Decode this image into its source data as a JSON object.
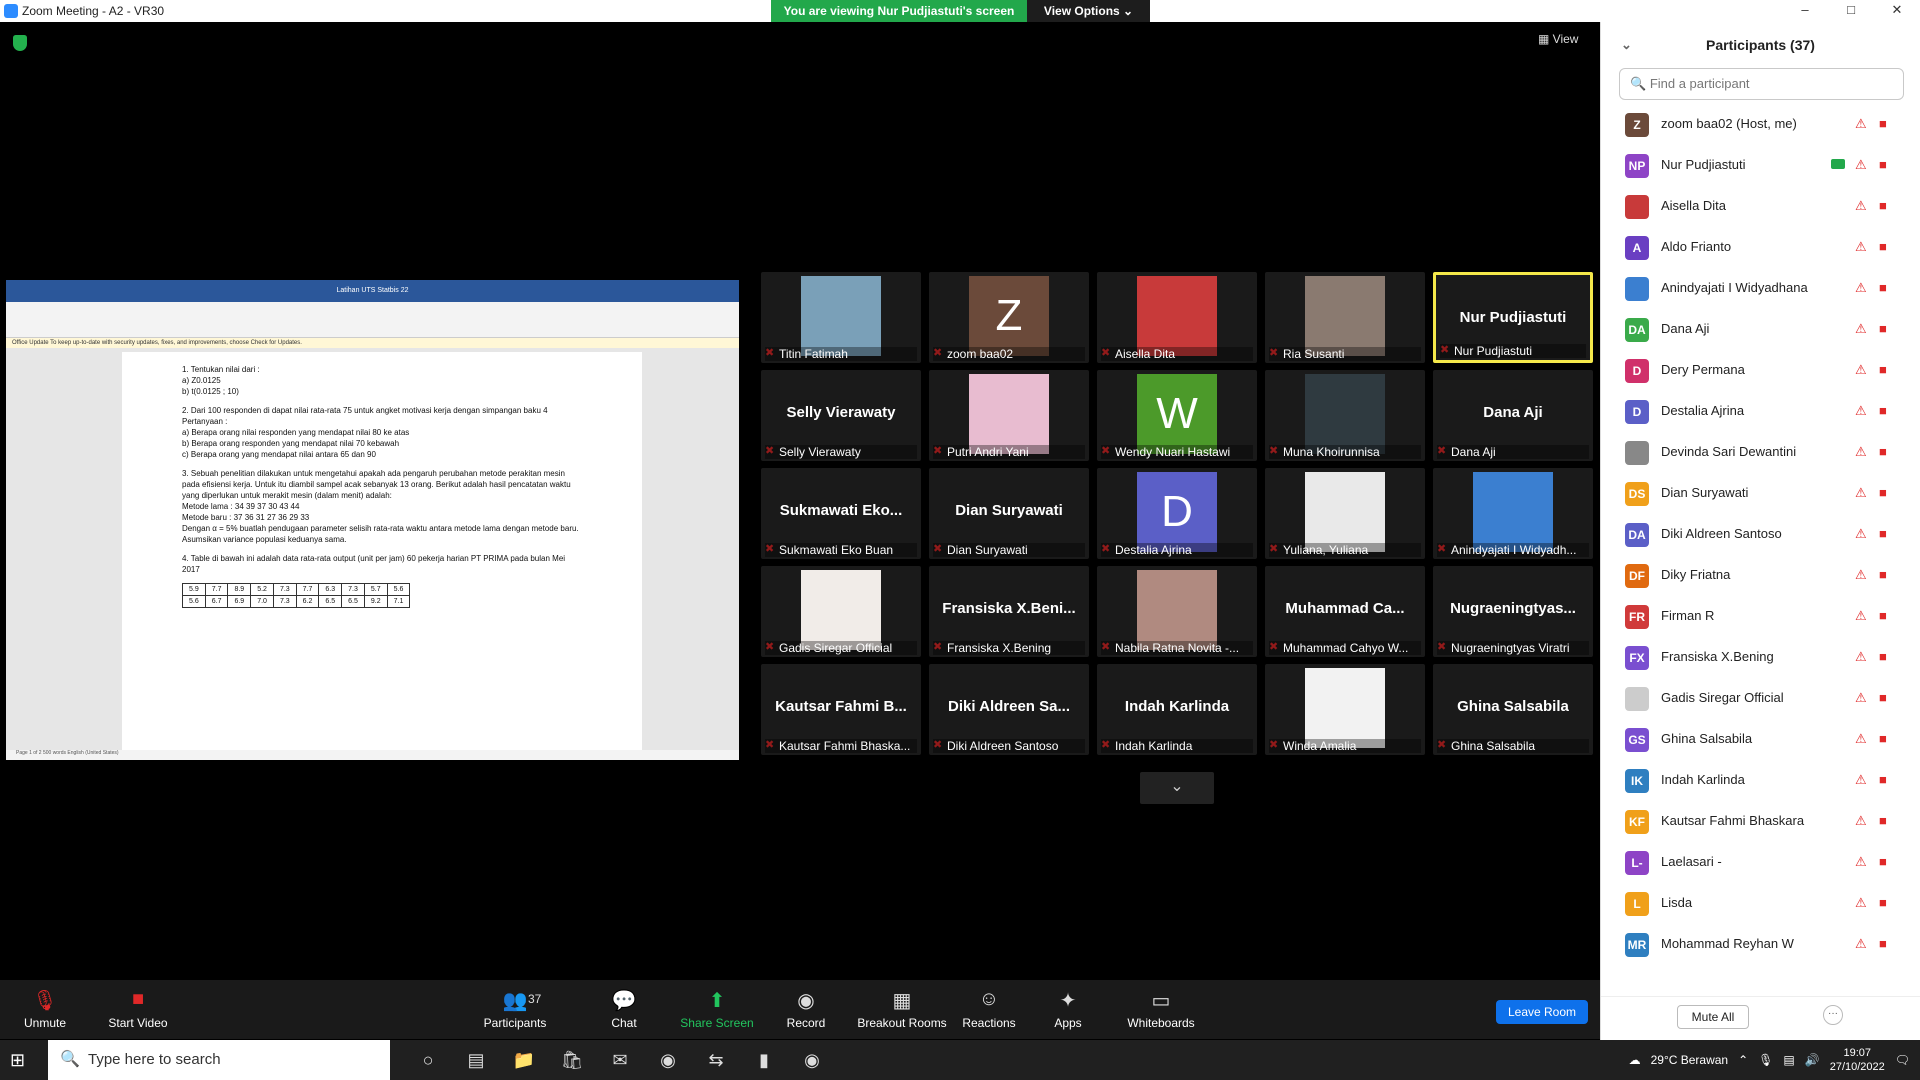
{
  "window": {
    "title": "Zoom Meeting - A2 - VR30",
    "controls": [
      "–",
      "□",
      "✕"
    ]
  },
  "banner": {
    "viewing": "You are viewing Nur Pudjiastuti's screen",
    "view_options": "View Options ⌄"
  },
  "view_button": "View",
  "shared_doc": {
    "title": "Latihan UTS Statbis 22",
    "notice": "Office Update  To keep up-to-date with security updates, fixes, and improvements, choose Check for Updates.",
    "lines": [
      "1.  Tentukan nilai dari :",
      "      a)  Z0.0125",
      "      b)  t(0.0125 ; 10)",
      "2.  Dari 100 responden di dapat nilai rata-rata  75 untuk angket motivasi kerja dengan simpangan baku 4",
      "     Pertanyaan :",
      "        a)  Berapa orang nilai responden yang mendapat nilai 80 ke atas",
      "        b)  Berapa orang responden yang mendapat nilai 70 kebawah",
      "        c)  Berapa orang yang mendapat nilai antara 65 dan 90",
      "3.  Sebuah penelitian dilakukan untuk mengetahui apakah ada pengaruh perubahan metode perakitan mesin pada efisiensi kerja. Untuk itu diambil sampel acak sebanyak 13 orang. Berikut adalah hasil pencatatan waktu yang diperlukan untuk merakit mesin (dalam menit) adalah:",
      "     Metode lama :  34    39    37    30    43    44",
      "     Metode baru :  37    36    31    27    36    29    33",
      "     Dengan α = 5% buatlah pendugaan parameter selisih rata-rata waktu antara metode lama dengan metode baru. Asumsikan variance populasi keduanya sama.",
      "4.  Table di bawah ini adalah data rata-rata output (unit per jam) 60 pekerja harian  PT PRIMA pada bulan Mei 2017"
    ],
    "table": [
      [
        "5.9",
        "7.7",
        "8.9",
        "5.2",
        "7.3",
        "7.7",
        "6.3",
        "7.3",
        "5.7",
        "5.6"
      ],
      [
        "5.6",
        "6.7",
        "6.9",
        "7.0",
        "7.3",
        "6.2",
        "6.5",
        "6.5",
        "9.2",
        "7.1"
      ]
    ],
    "status": "Page 1 of 2     500 words     English (United States)"
  },
  "tiles": [
    {
      "name": "Titin Fatimah",
      "type": "photo",
      "color": "#7aa0b8"
    },
    {
      "name": "zoom baa02",
      "type": "letter",
      "letter": "Z",
      "color": "#6b4a3a"
    },
    {
      "name": "Aisella Dita",
      "type": "photo",
      "color": "#c83a3a"
    },
    {
      "name": "Ria Susanti",
      "type": "photo",
      "color": "#8a7a70"
    },
    {
      "name": "Nur Pudjiastuti",
      "type": "text",
      "big": "Nur Pudjiastuti",
      "active": true
    },
    {
      "name": "Selly Vierawaty",
      "type": "text",
      "big": "Selly Vierawaty"
    },
    {
      "name": "Putri Andri Yani",
      "type": "photo",
      "color": "#e8bcd0"
    },
    {
      "name": "Wendy Nuari Hastawi",
      "type": "letter",
      "letter": "W",
      "color": "#4c9a2a"
    },
    {
      "name": "Muna Khoirunnisa",
      "type": "photo",
      "color": "#2f3a40"
    },
    {
      "name": "Dana Aji",
      "type": "text",
      "big": "Dana Aji"
    },
    {
      "name": "Sukmawati Eko Buan",
      "type": "text",
      "big": "Sukmawati  Eko..."
    },
    {
      "name": "Dian Suryawati",
      "type": "text",
      "big": "Dian Suryawati"
    },
    {
      "name": "Destalia Ajrina",
      "type": "letter",
      "letter": "D",
      "color": "#5b5fc7"
    },
    {
      "name": "Yuliana, Yuliana",
      "type": "photo",
      "color": "#e9e9e9"
    },
    {
      "name": "Anindyajati I Widyadh...",
      "type": "photo",
      "color": "#3b7fd0"
    },
    {
      "name": "Gadis Siregar Official",
      "type": "photo",
      "color": "#f1ece8"
    },
    {
      "name": "Fransiska X.Bening",
      "type": "text",
      "big": "Fransiska  X.Beni..."
    },
    {
      "name": "Nabila Ratna Novita -...",
      "type": "photo",
      "color": "#b08a80"
    },
    {
      "name": "Muhammad Cahyo W...",
      "type": "text",
      "big": "Muhammad  Ca..."
    },
    {
      "name": "Nugraeningtyas Viratri",
      "type": "text",
      "big": "Nugraeningtyas..."
    },
    {
      "name": "Kautsar Fahmi Bhaska...",
      "type": "text",
      "big": "Kautsar Fahmi B..."
    },
    {
      "name": "Diki Aldreen Santoso",
      "type": "text",
      "big": "Diki Aldreen Sa..."
    },
    {
      "name": "Indah Karlinda",
      "type": "text",
      "big": "Indah Karlinda"
    },
    {
      "name": "Winda Amalia",
      "type": "photo",
      "color": "#f2f2f2"
    },
    {
      "name": "Ghina Salsabila",
      "type": "text",
      "big": "Ghina Salsabila"
    }
  ],
  "toolbar": {
    "unmute": "Unmute",
    "start_video": "Start Video",
    "participants": "Participants",
    "participants_count": "37",
    "chat": "Chat",
    "share_screen": "Share Screen",
    "record": "Record",
    "breakout": "Breakout Rooms",
    "reactions": "Reactions",
    "apps": "Apps",
    "whiteboards": "Whiteboards",
    "leave": "Leave Room"
  },
  "panel": {
    "title": "Participants (37)",
    "search_placeholder": "Find a participant",
    "participants": [
      {
        "initials": "Z",
        "name": "zoom baa02 (Host, me)",
        "color": "#6b4a3a"
      },
      {
        "initials": "NP",
        "name": "Nur Pudjiastuti",
        "color": "#8e44c6",
        "sharing": true
      },
      {
        "initials": "",
        "name": "Aisella Dita",
        "color": "#c83a3a"
      },
      {
        "initials": "A",
        "name": "Aldo Frianto",
        "color": "#6a3fc2"
      },
      {
        "initials": "",
        "name": "Anindyajati I Widyadhana",
        "color": "#3b7fd0"
      },
      {
        "initials": "DA",
        "name": "Dana Aji",
        "color": "#3aaa4a"
      },
      {
        "initials": "D",
        "name": "Dery Permana",
        "color": "#d0306a"
      },
      {
        "initials": "D",
        "name": "Destalia Ajrina",
        "color": "#5b5fc7"
      },
      {
        "initials": "",
        "name": "Devinda Sari Dewantini",
        "color": "#888888"
      },
      {
        "initials": "DS",
        "name": "Dian Suryawati",
        "color": "#f0a01a"
      },
      {
        "initials": "DA",
        "name": "Diki Aldreen Santoso",
        "color": "#5b5fc7"
      },
      {
        "initials": "DF",
        "name": "Diky Friatna",
        "color": "#e06a10"
      },
      {
        "initials": "FR",
        "name": "Firman R",
        "color": "#d03a3a"
      },
      {
        "initials": "FX",
        "name": "Fransiska X.Bening",
        "color": "#7a4fd0"
      },
      {
        "initials": "",
        "name": "Gadis Siregar Official",
        "color": "#cccccc"
      },
      {
        "initials": "GS",
        "name": "Ghina Salsabila",
        "color": "#7a4fd0"
      },
      {
        "initials": "IK",
        "name": "Indah Karlinda",
        "color": "#2f7fc0"
      },
      {
        "initials": "KF",
        "name": "Kautsar Fahmi Bhaskara",
        "color": "#f0a01a"
      },
      {
        "initials": "L-",
        "name": "Laelasari -",
        "color": "#8e44c6"
      },
      {
        "initials": "L",
        "name": "Lisda",
        "color": "#f0a01a"
      },
      {
        "initials": "MR",
        "name": "Mohammad Reyhan W",
        "color": "#2f7fc0"
      }
    ],
    "mute_all": "Mute All",
    "more": "···"
  },
  "taskbar": {
    "search_placeholder": "Type here to search",
    "weather": "29°C  Berawan",
    "time": "19:07",
    "date": "27/10/2022"
  }
}
